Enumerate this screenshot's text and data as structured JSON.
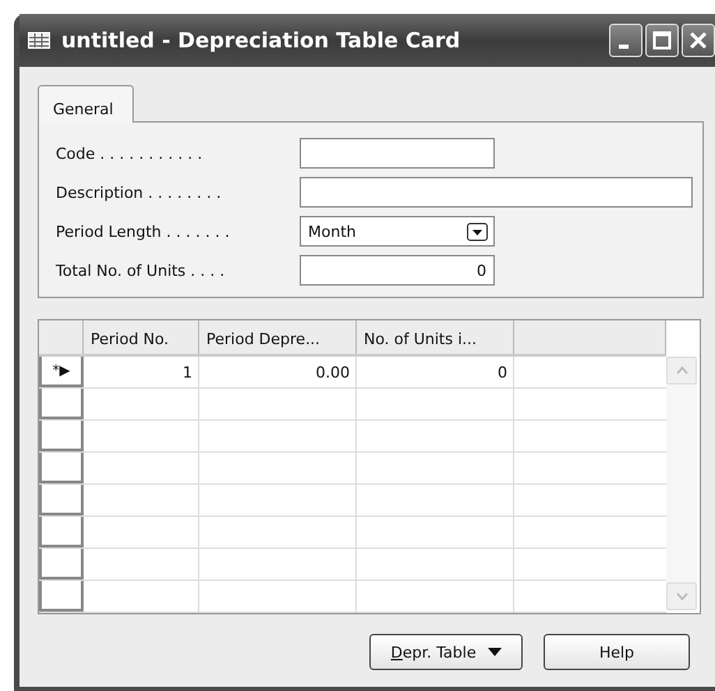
{
  "window": {
    "title": "untitled - Depreciation Table Card"
  },
  "tabs": [
    {
      "label": "General",
      "selected": true
    }
  ],
  "fields": [
    {
      "label": "Code . . . . . . . . . . .",
      "kind": "text",
      "wide": false
    },
    {
      "label": "Description . . . . . . . .",
      "kind": "text",
      "wide": true
    },
    {
      "label": "Period Length . . . . . . .",
      "kind": "dropdown",
      "value": "Month",
      "wide": false
    },
    {
      "label": "Total No. of Units . . . .",
      "kind": "number",
      "value": "0",
      "wide": false
    }
  ],
  "table": {
    "columns": [
      "Period No.",
      "Period Depre...",
      "No. of Units i..."
    ],
    "rows": [
      {
        "marker": "*▶",
        "cells": [
          "1",
          "0.00",
          "0"
        ]
      }
    ]
  },
  "buttons": [
    {
      "label_parts": [
        {
          "text": "D",
          "underlined": true
        },
        {
          "text": "epr. Table",
          "underlined": false
        }
      ],
      "kind": "menu"
    },
    {
      "label_parts": [
        {
          "text": "Help",
          "underlined": false
        }
      ],
      "kind": "plain"
    }
  ]
}
